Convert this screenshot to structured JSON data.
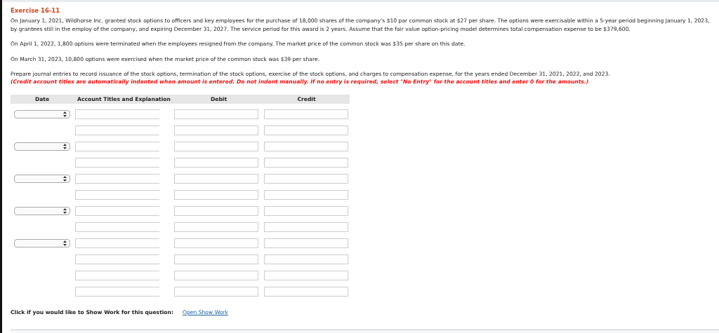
{
  "exercise_title": "Exercise 16-11",
  "paragraphs": [
    "On January 1, 2021, Wildhorse Inc. granted stock options to officers and key employees for the purchase of 18,000 shares of the company’s $10 par common stock at $27 per share. The options were exercisable within a 5-year period beginning January 1, 2023, by grantees still in the employ of the company, and expiring December 31, 2027. The service period for this award is 2 years. Assume that the fair value option-pricing model determines total compensation expense to be $379,600.",
    "On April 1, 2022, 1,800 options were terminated when the employees resigned from the company. The market price of the common stock was $35 per share on this date.",
    "On March 31, 2023, 10,800 options were exercised when the market price of the common stock was $39 per share."
  ],
  "instruction": "Prepare journal entries to record issuance of the stock options, termination of the stock options, exercise of the stock options, and charges to compensation expense, for the years ended December 31, 2021, 2022, and 2023.",
  "warning": "(Credit account titles are automatically indented when amount is entered. Do not indent manually. If no entry is required, select \"No Entry\" for the account titles and enter 0 for the amounts.)",
  "table": {
    "columns": [
      "Date",
      "Account Titles and Explanation",
      "Debit",
      "Credit"
    ],
    "rows": [
      {
        "kind": "date"
      },
      {
        "kind": "line"
      },
      {
        "kind": "date"
      },
      {
        "kind": "line"
      },
      {
        "kind": "date"
      },
      {
        "kind": "line"
      },
      {
        "kind": "date"
      },
      {
        "kind": "line"
      },
      {
        "kind": "date"
      },
      {
        "kind": "line"
      },
      {
        "kind": "line"
      },
      {
        "kind": "line"
      }
    ]
  },
  "show_work": {
    "prompt": "Click if you would like to Show Work for this question:",
    "link": "Open Show Work"
  }
}
